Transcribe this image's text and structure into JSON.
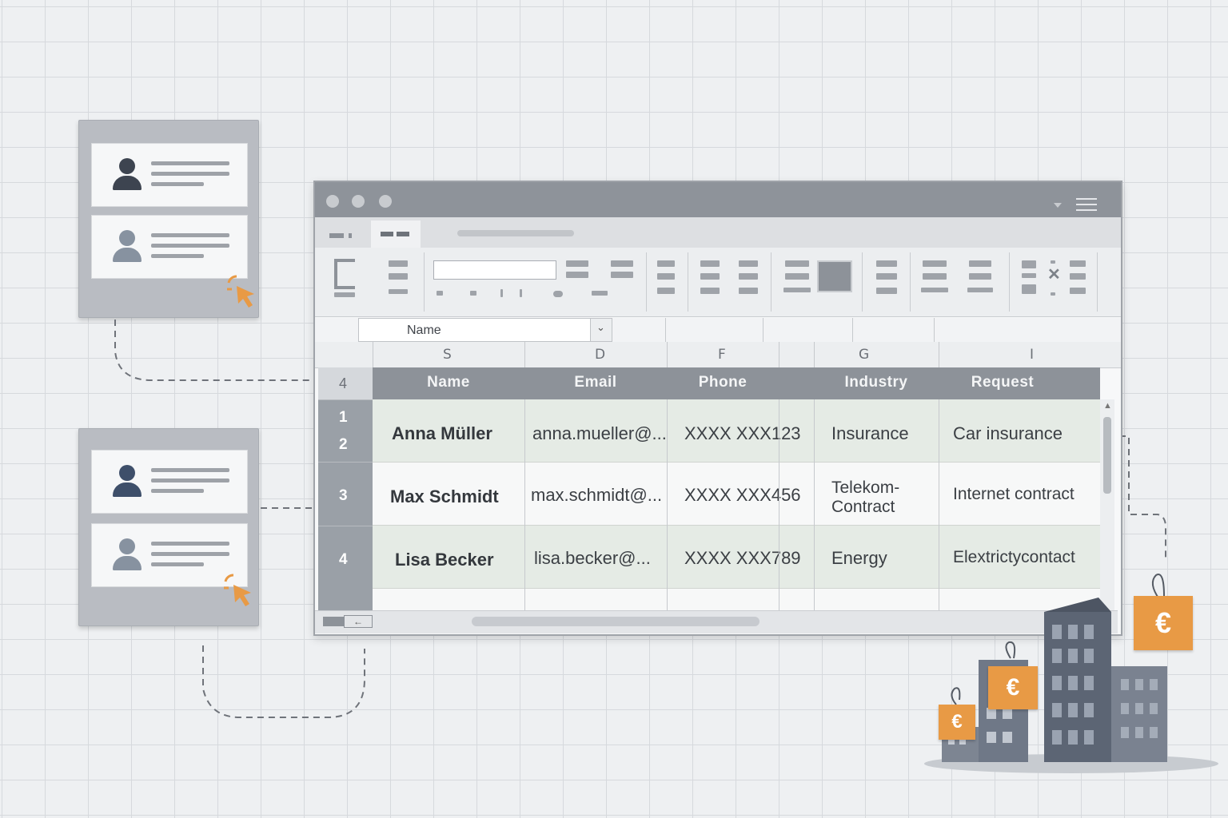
{
  "left_cards": [
    {
      "items": [
        {
          "avatar_color": "#3d4450"
        },
        {
          "avatar_color": "#8792a0"
        }
      ]
    },
    {
      "items": [
        {
          "avatar_color": "#3e4f6a"
        },
        {
          "avatar_color": "#8792a0"
        }
      ]
    }
  ],
  "accent_color": "#e89a45",
  "spreadsheet": {
    "name_box": "Name",
    "column_letters": [
      "S",
      "D",
      "F",
      "G",
      "I"
    ],
    "header_row_number": "4",
    "headers": [
      "Name",
      "Email",
      "Phone",
      "Industry",
      "Request"
    ],
    "rows": [
      {
        "numbers": [
          "1",
          "2"
        ],
        "name": "Anna Müller",
        "email": "anna.mueller@...",
        "phone": "XXXX XXX123",
        "industry": [
          "Insurance"
        ],
        "request": "Car insurance"
      },
      {
        "numbers": [
          "3"
        ],
        "name": "Max Schmidt",
        "email": "max.schmidt@...",
        "phone": "XXXX XXX456",
        "industry": [
          "Telekom-",
          "Contract"
        ],
        "request": "Internet contract"
      },
      {
        "numbers": [
          "4"
        ],
        "name": "Lisa Becker",
        "email": "lisa.becker@...",
        "phone": "XXXX XXX789",
        "industry": [
          "Energy"
        ],
        "request": "Elextrictycontact"
      }
    ]
  },
  "price_tags": [
    "€",
    "€",
    "€"
  ]
}
